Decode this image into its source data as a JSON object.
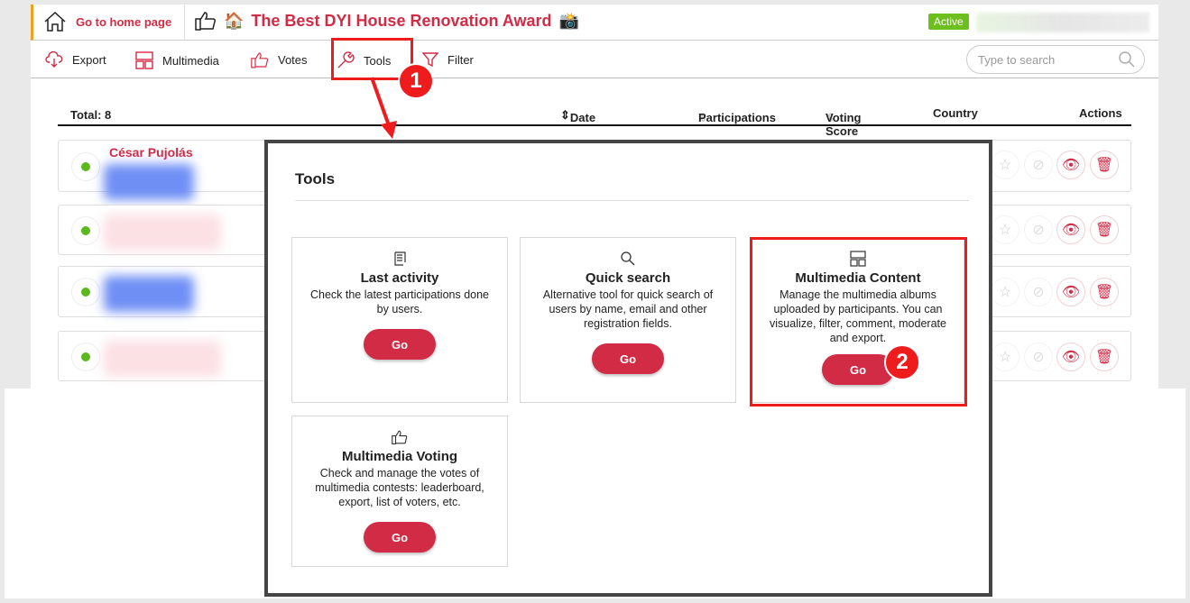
{
  "header": {
    "home_label": "Go to home page",
    "title": "The Best DYI House Renovation Award",
    "title_prefix_emoji": "🏠",
    "title_suffix_emoji": "📸",
    "status_badge": "Active"
  },
  "toolbar": {
    "items": [
      {
        "label": "Export",
        "icon": "cloud-download-icon"
      },
      {
        "label": "Multimedia",
        "icon": "layout-icon"
      },
      {
        "label": "Votes",
        "icon": "thumbs-up-icon"
      },
      {
        "label": "Tools",
        "icon": "wrench-icon"
      },
      {
        "label": "Filter",
        "icon": "filter-icon"
      }
    ],
    "search_placeholder": "Type to search"
  },
  "table": {
    "total": "Total: 8",
    "columns": [
      "Date",
      "Participations",
      "Voting Score",
      "Country",
      "Actions"
    ],
    "rows": [
      {
        "name": "César Pujolás"
      },
      {
        "name": ""
      },
      {
        "name": ""
      },
      {
        "name": ""
      }
    ]
  },
  "modal": {
    "title": "Tools",
    "cards": [
      {
        "title": "Last activity",
        "desc": "Check the latest participations done by users.",
        "button": "Go",
        "icon": "scroll-icon"
      },
      {
        "title": "Quick search",
        "desc": "Alternative tool for quick search of users by name, email and other registration fields.",
        "button": "Go",
        "icon": "search-icon"
      },
      {
        "title": "Multimedia Content",
        "desc": "Manage the multimedia albums uploaded by participants. You can visualize, filter, comment, moderate and export.",
        "button": "Go",
        "icon": "layout-icon"
      },
      {
        "title": "Multimedia Voting",
        "desc": "Check and manage the votes of multimedia contests: leaderboard, export, list of voters, etc.",
        "button": "Go",
        "icon": "thumbs-up-icon"
      }
    ]
  },
  "annotations": {
    "step1": "1",
    "step2": "2",
    "color": "#ee1c1c"
  },
  "colors": {
    "accent": "#d22b45",
    "active": "#6cbf1c"
  }
}
